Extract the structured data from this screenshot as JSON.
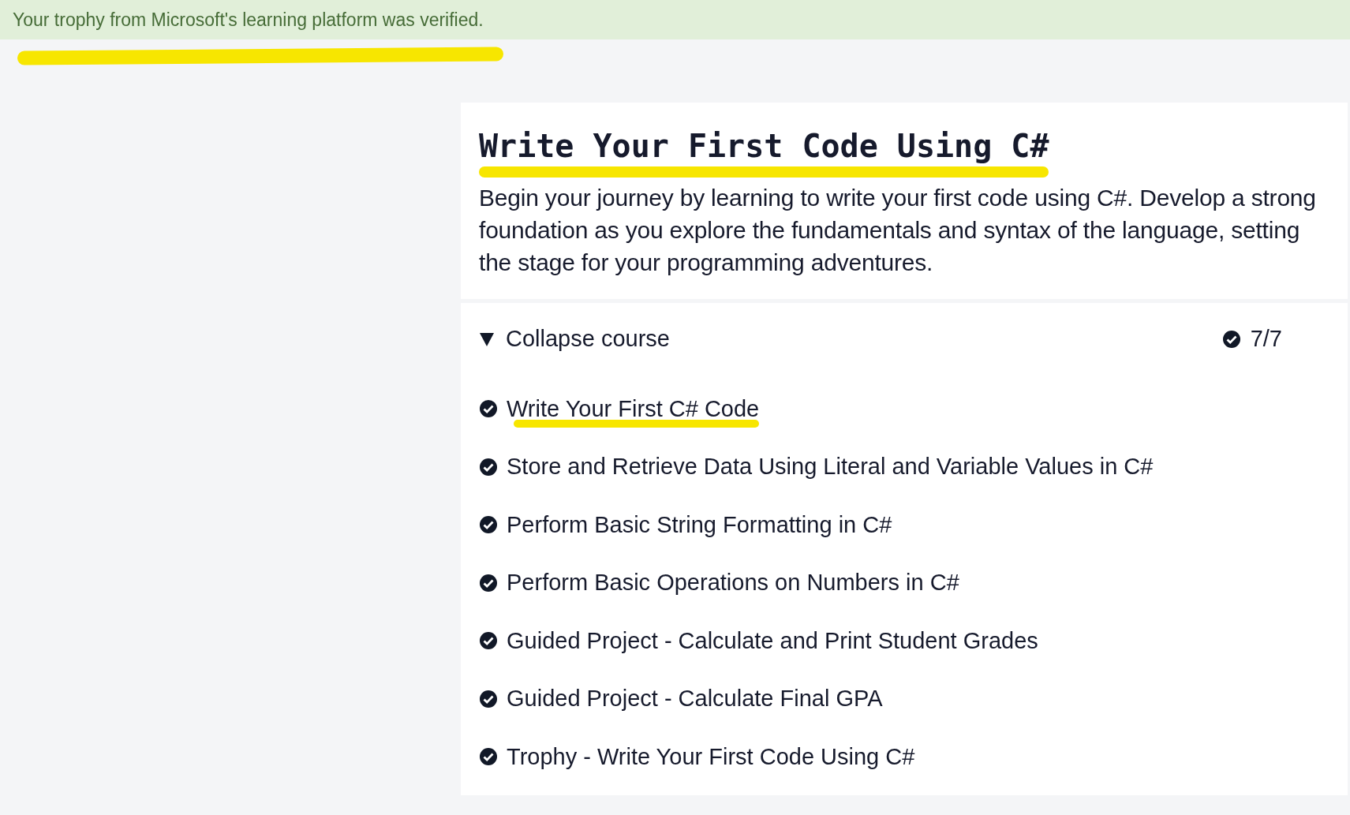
{
  "banner": {
    "message": "Your trophy from Microsoft's learning platform was verified."
  },
  "course": {
    "title": "Write Your First Code Using C#",
    "description": "Begin your journey by learning to write your first code using C#. Develop a strong foundation as you explore the fundamentals and syntax of the language, setting the stage for your programming adventures.",
    "toggle_label": "Collapse course",
    "expanded": true,
    "progress": "7/7",
    "lessons": [
      {
        "title": "Write Your First C# Code",
        "completed": true
      },
      {
        "title": "Store and Retrieve Data Using Literal and Variable Values in C#",
        "completed": true
      },
      {
        "title": "Perform Basic String Formatting in C#",
        "completed": true
      },
      {
        "title": "Perform Basic Operations on Numbers in C#",
        "completed": true
      },
      {
        "title": "Guided Project - Calculate and Print Student Grades",
        "completed": true
      },
      {
        "title": "Guided Project - Calculate Final GPA",
        "completed": true
      },
      {
        "title": "Trophy - Write Your First Code Using C#",
        "completed": true
      }
    ]
  }
}
